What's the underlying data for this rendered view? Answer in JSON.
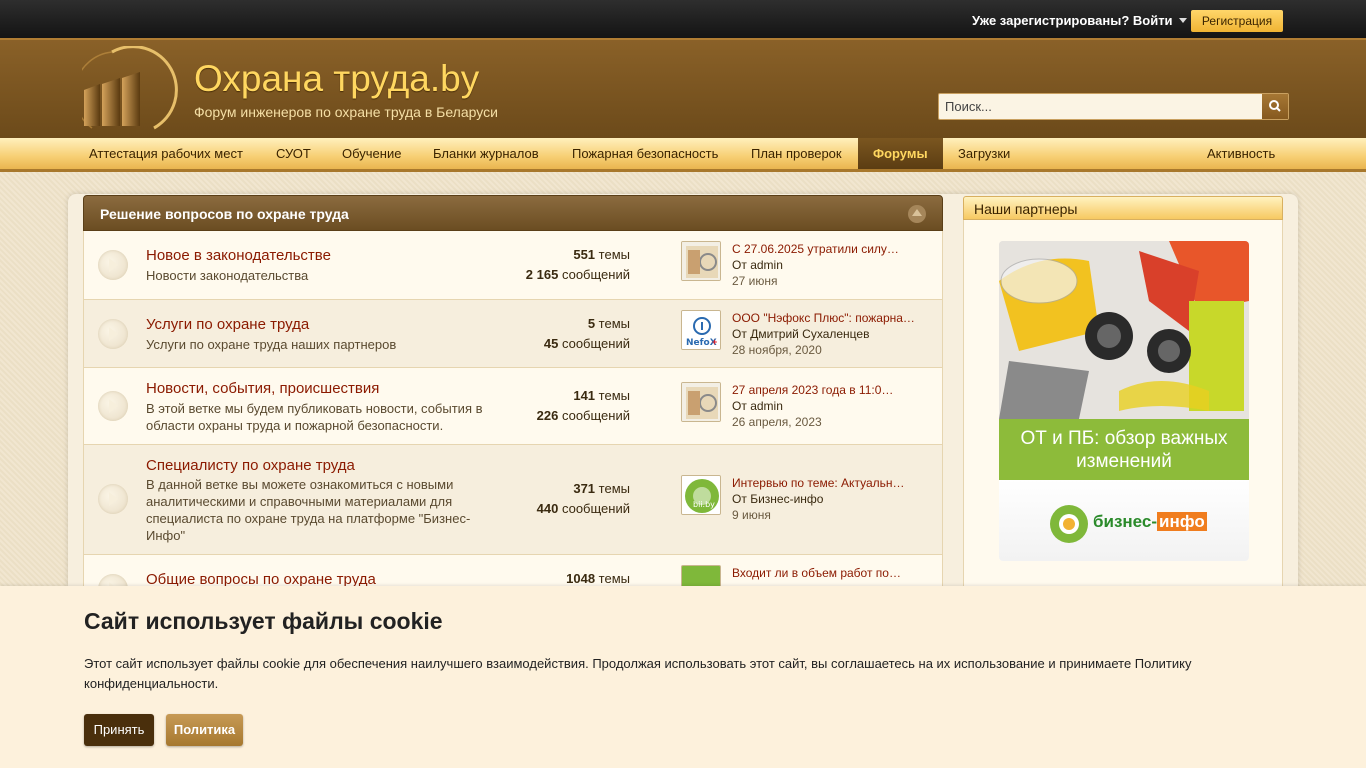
{
  "topbar": {
    "login_label": "Уже зарегистрированы? Войти",
    "register_label": "Регистрация"
  },
  "header": {
    "site_title": "Охрана труда.by",
    "subtitle": "Форум инженеров по охране труда в Беларуси",
    "search_placeholder": "Поиск..."
  },
  "nav": {
    "items": [
      {
        "label": "Аттестация рабочих мест"
      },
      {
        "label": "СУОТ"
      },
      {
        "label": "Обучение"
      },
      {
        "label": "Бланки журналов"
      },
      {
        "label": "Пожарная безопасность"
      },
      {
        "label": "План проверок"
      },
      {
        "label": "Форумы",
        "active": true
      },
      {
        "label": "Загрузки"
      }
    ],
    "activity_label": "Активность"
  },
  "category": {
    "title": "Решение вопросов по охране труда",
    "nodes": [
      {
        "title": "Новое в законодательстве",
        "desc": "Новости законодательства",
        "threads": "551",
        "threads_label": "темы",
        "messages": "2 165",
        "messages_label": "сообщений",
        "last_title": "С 27.06.2025 утратили силу…",
        "last_by": "От",
        "last_user": "admin",
        "last_date": "27 июня"
      },
      {
        "title": "Услуги по охране труда",
        "desc": "Услуги по охране труда наших партнеров",
        "threads": "5",
        "threads_label": "темы",
        "messages": "45",
        "messages_label": "сообщений",
        "last_title": "ООО \"Нэфокс Плюс\": пожарна…",
        "last_by": "От",
        "last_user": "Дмитрий Сухаленцев",
        "last_date": "28 ноября, 2020"
      },
      {
        "title": "Новости, события, происшествия",
        "desc": "В этой ветке мы будем публиковать новости, события в области охраны труда и пожарной безопасности.",
        "threads": "141",
        "threads_label": "темы",
        "messages": "226",
        "messages_label": "сообщений",
        "last_title": "27 апреля 2023 года в 11:0…",
        "last_by": "От",
        "last_user": "admin",
        "last_date": "26 апреля, 2023"
      },
      {
        "title": "Специалисту по охране труда",
        "desc": "В данной ветке вы можете ознакомиться с новыми аналитическими и справочными материалами для специалиста по охране труда на платформе \"Бизнес-Инфо\"",
        "threads": "371",
        "threads_label": "темы",
        "messages": "440",
        "messages_label": "сообщений",
        "last_title": "Интервью по теме: Актуальн…",
        "last_by": "От",
        "last_user": "Бизнес-инфо",
        "last_date": "9 июня"
      },
      {
        "title": "Общие вопросы по охране труда",
        "threads": "1048",
        "threads_label": "темы",
        "last_title": "Входит ли в объем работ по…"
      }
    ]
  },
  "sidebar": {
    "partners_title": "Наши партнеры",
    "banner_text": "ОТ и ПБ: обзор важных изменений",
    "banner_logo_a": "бизнес-",
    "banner_logo_b": "инфо"
  },
  "cookie": {
    "title": "Сайт использует файлы cookie",
    "text": "Этот сайт использует файлы cookie для обеспечения наилучшего взаимодействия. Продолжая использовать этот сайт, вы соглашаетесь на их использование и принимаете Политику конфиденциальности.",
    "accept_label": "Принять",
    "policy_label": "Политика"
  },
  "icons": {
    "search": "search-icon",
    "collapse": "collapse-up-icon",
    "node": "forum-node-icon",
    "login_caret": "chevron-down-icon"
  },
  "colors": {
    "brand_gold": "#ffd760",
    "header_brown": "#7a5520",
    "link_red": "#8b1a00",
    "banner_green": "#8dbb3a"
  }
}
